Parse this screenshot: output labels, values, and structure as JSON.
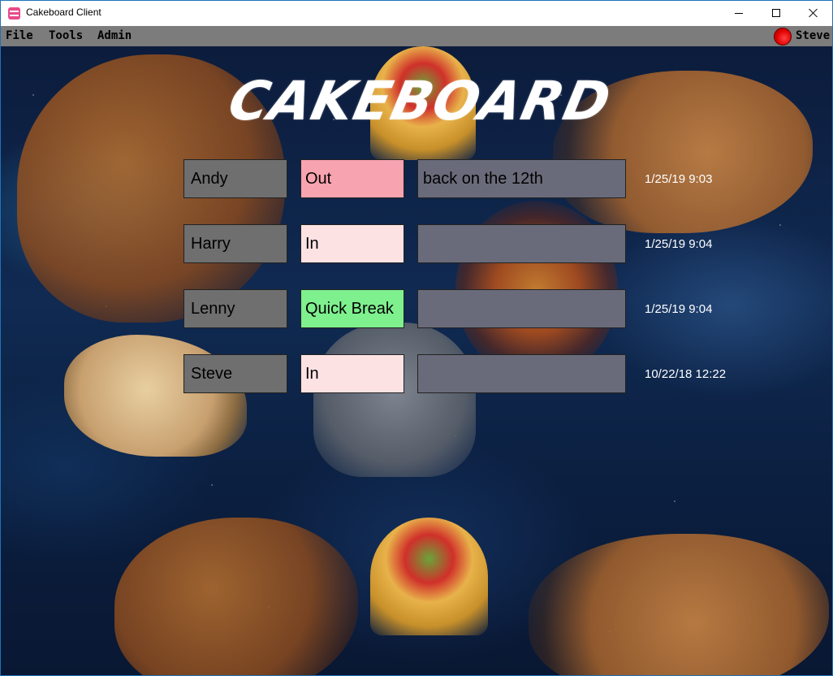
{
  "window": {
    "title": "Cakeboard Client"
  },
  "menu": {
    "file": "File",
    "tools": "Tools",
    "admin": "Admin"
  },
  "user": {
    "name": "Steve",
    "status_indicator_color": "#e00000"
  },
  "logo": {
    "text": "CAKEBOARD"
  },
  "colors": {
    "status_out": "#f8a3b0",
    "status_in": "#fde2e4",
    "status_quick_break": "#7ef08e",
    "name_cell": "#6f6f6f",
    "note_cell": "#6a6b7a"
  },
  "board": {
    "rows": [
      {
        "name": "Andy",
        "status": "Out",
        "status_color": "#f8a3b0",
        "note": "back on the 12th",
        "timestamp": "1/25/19 9:03"
      },
      {
        "name": "Harry",
        "status": "In",
        "status_color": "#fde2e4",
        "note": "",
        "timestamp": "1/25/19 9:04"
      },
      {
        "name": "Lenny",
        "status": "Quick Break",
        "status_color": "#7ef08e",
        "note": "",
        "timestamp": "1/25/19 9:04"
      },
      {
        "name": "Steve",
        "status": "In",
        "status_color": "#fde2e4",
        "note": "",
        "timestamp": "10/22/18 12:22"
      }
    ]
  }
}
